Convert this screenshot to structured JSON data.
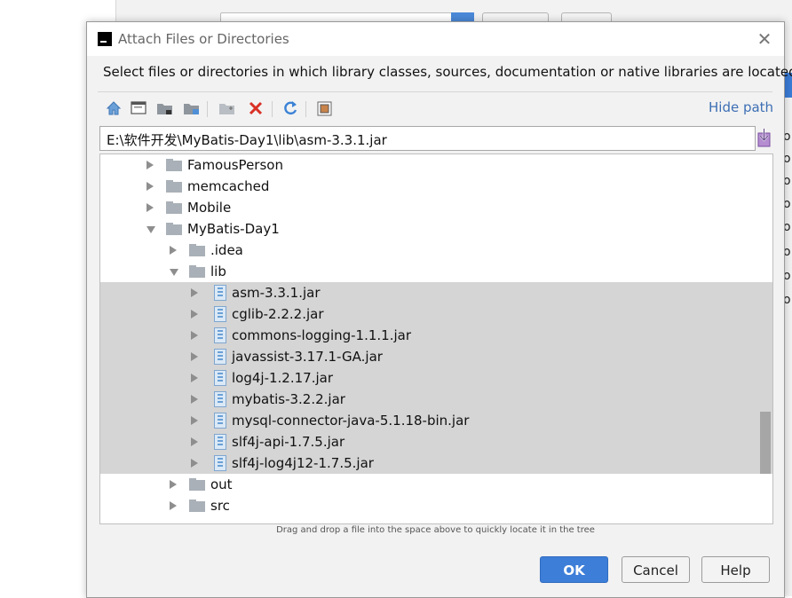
{
  "background": {
    "o_glyphs": [
      "o",
      "o",
      "o",
      "o",
      "o",
      "o",
      "o",
      "o"
    ]
  },
  "dialog": {
    "title": "Attach Files or Directories",
    "description": "Select files or directories in which library classes, sources, documentation or native libraries are located",
    "hide_path_label": "Hide path",
    "path_value": "E:\\软件开发\\MyBatis-Day1\\lib\\asm-3.3.1.jar",
    "toolbar_icons": [
      "home-icon",
      "desktop-icon",
      "project-folder-icon",
      "module-folder-icon",
      "new-folder-icon",
      "delete-icon",
      "refresh-icon",
      "show-hidden-icon"
    ],
    "tree": [
      {
        "label": "FamousPerson",
        "type": "folder",
        "expanded": false,
        "depth": 0,
        "selected": false
      },
      {
        "label": "memcached",
        "type": "folder",
        "expanded": false,
        "depth": 0,
        "selected": false
      },
      {
        "label": "Mobile",
        "type": "folder",
        "expanded": false,
        "depth": 0,
        "selected": false
      },
      {
        "label": "MyBatis-Day1",
        "type": "folder",
        "expanded": true,
        "depth": 0,
        "selected": false
      },
      {
        "label": ".idea",
        "type": "folder",
        "expanded": false,
        "depth": 1,
        "selected": false
      },
      {
        "label": "lib",
        "type": "folder",
        "expanded": true,
        "depth": 1,
        "selected": false
      },
      {
        "label": "asm-3.3.1.jar",
        "type": "jar",
        "expanded": false,
        "depth": 2,
        "selected": true
      },
      {
        "label": "cglib-2.2.2.jar",
        "type": "jar",
        "expanded": false,
        "depth": 2,
        "selected": true
      },
      {
        "label": "commons-logging-1.1.1.jar",
        "type": "jar",
        "expanded": false,
        "depth": 2,
        "selected": true
      },
      {
        "label": "javassist-3.17.1-GA.jar",
        "type": "jar",
        "expanded": false,
        "depth": 2,
        "selected": true
      },
      {
        "label": "log4j-1.2.17.jar",
        "type": "jar",
        "expanded": false,
        "depth": 2,
        "selected": true
      },
      {
        "label": "mybatis-3.2.2.jar",
        "type": "jar",
        "expanded": false,
        "depth": 2,
        "selected": true
      },
      {
        "label": "mysql-connector-java-5.1.18-bin.jar",
        "type": "jar",
        "expanded": false,
        "depth": 2,
        "selected": true
      },
      {
        "label": "slf4j-api-1.7.5.jar",
        "type": "jar",
        "expanded": false,
        "depth": 2,
        "selected": true
      },
      {
        "label": "slf4j-log4j12-1.7.5.jar",
        "type": "jar",
        "expanded": false,
        "depth": 2,
        "selected": true
      },
      {
        "label": "out",
        "type": "folder",
        "expanded": false,
        "depth": 1,
        "selected": false
      },
      {
        "label": "src",
        "type": "folder",
        "expanded": false,
        "depth": 1,
        "selected": false
      }
    ],
    "drag_hint": "Drag and drop a file into the space above to quickly locate it in the tree",
    "buttons": {
      "ok": "OK",
      "cancel": "Cancel",
      "help": "Help"
    },
    "colors": {
      "accent": "#3d7ed8",
      "link": "#3d6fb4",
      "selection": "#d5d5d5",
      "delete": "#d93025"
    }
  }
}
